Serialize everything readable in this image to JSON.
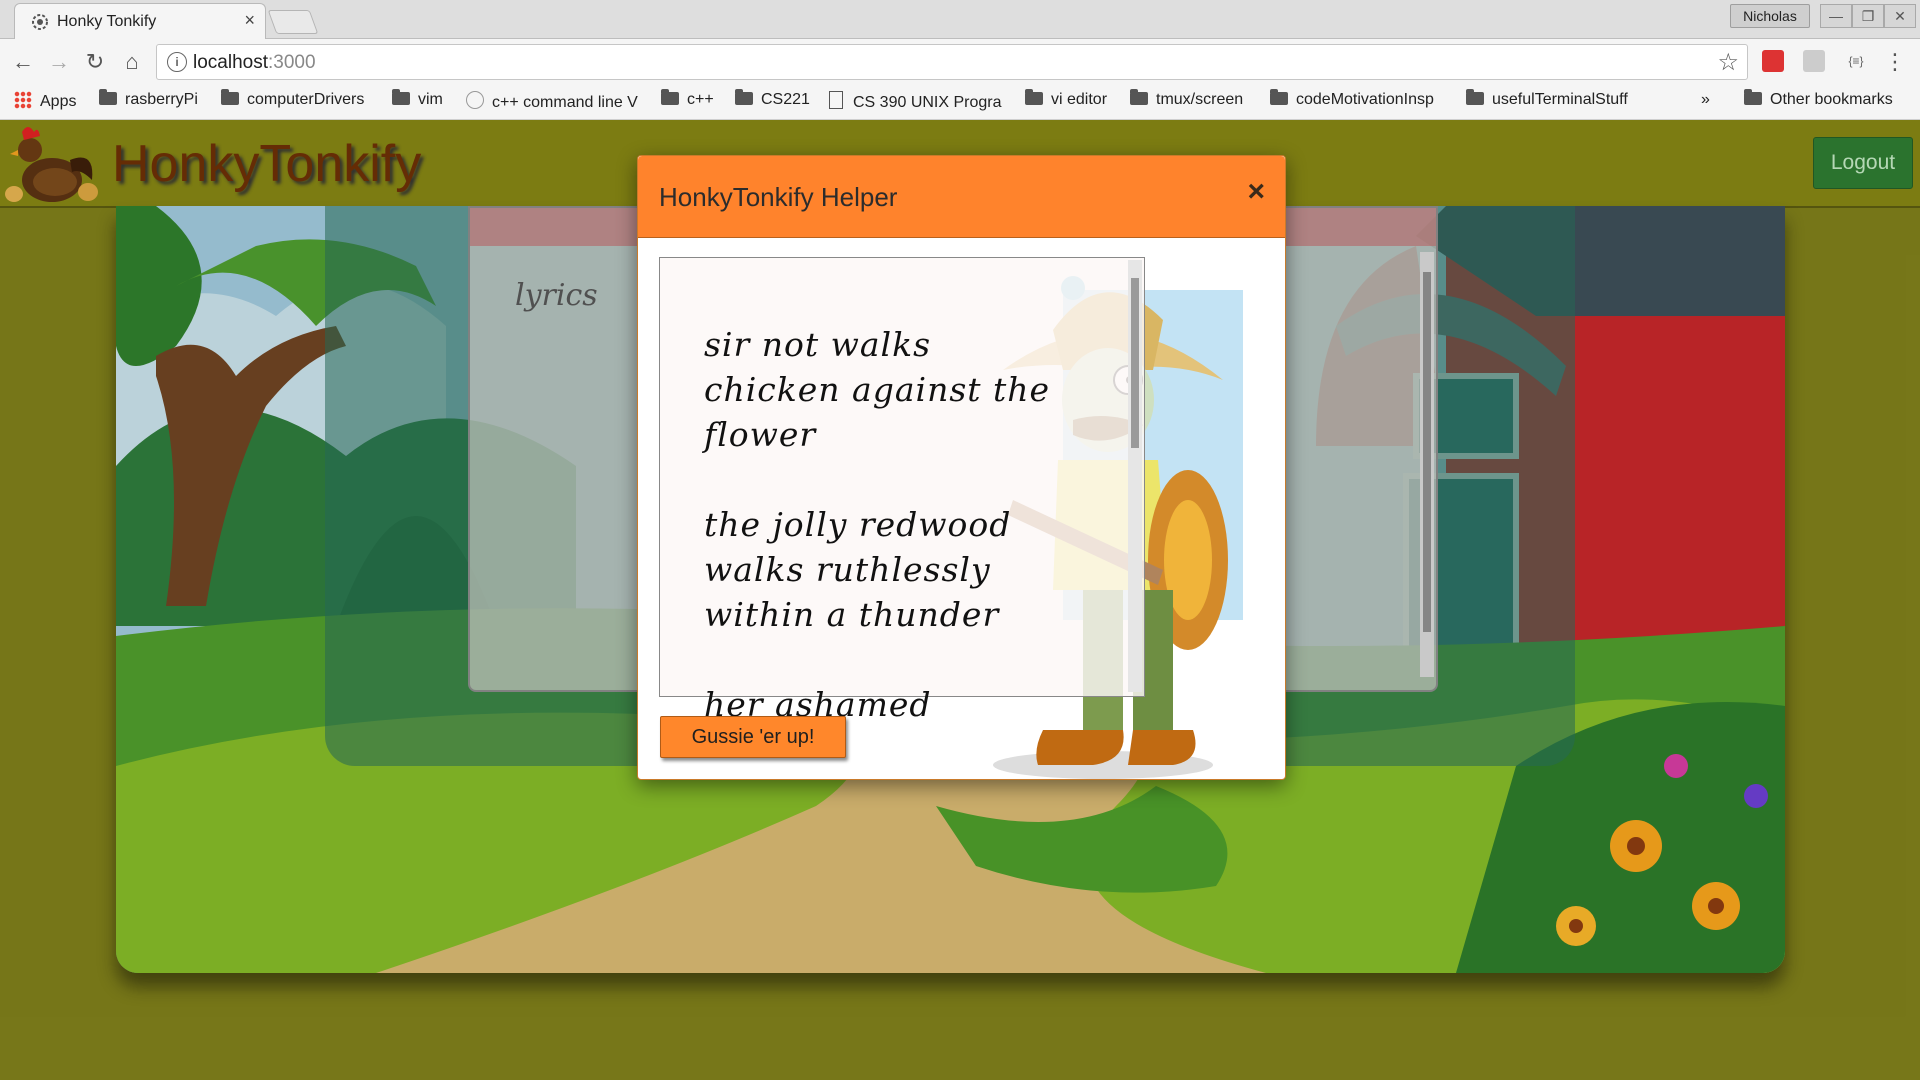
{
  "browser": {
    "tab_title": "Honky Tonkify",
    "tab_close": "×",
    "profile_name": "Nicholas",
    "url_host": "localhost",
    "url_port": ":3000",
    "bookmarks": [
      {
        "label": "Apps",
        "type": "apps"
      },
      {
        "label": "rasberryPi",
        "type": "folder"
      },
      {
        "label": "computerDrivers",
        "type": "folder"
      },
      {
        "label": "vim",
        "type": "folder"
      },
      {
        "label": "c++ command line V",
        "type": "link"
      },
      {
        "label": "c++",
        "type": "folder"
      },
      {
        "label": "CS221",
        "type": "folder"
      },
      {
        "label": "CS 390 UNIX Progra",
        "type": "page"
      },
      {
        "label": "vi editor",
        "type": "folder"
      },
      {
        "label": "tmux/screen",
        "type": "folder"
      },
      {
        "label": "codeMotivationInsp",
        "type": "folder"
      },
      {
        "label": "usefulTerminalStuff",
        "type": "folder"
      }
    ],
    "overflow_label": "»",
    "other_bookmarks": "Other bookmarks"
  },
  "app": {
    "brand": "HonkyTonkify",
    "logout_label": "Logout",
    "lyrics_placeholder": "lyrics"
  },
  "modal": {
    "title": "HonkyTonkify Helper",
    "close_symbol": "×",
    "lyrics": "sir not walks\nchicken against the\nflower\n\nthe jolly redwood\nwalks ruthlessly\nwithin a thunder\n\nher ashamed",
    "button_label": "Gussie 'er up!"
  },
  "colors": {
    "navbar": "#838314",
    "page_background": "#7d7d1a",
    "modal_header": "#ff832c",
    "button": "#ff872b",
    "logout": "#2e7a31"
  }
}
